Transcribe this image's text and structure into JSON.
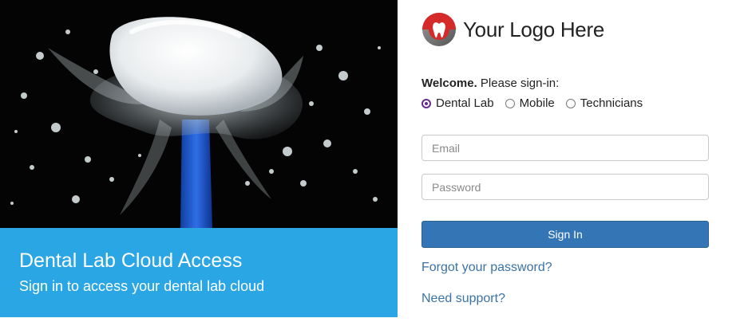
{
  "hero": {
    "title": "Dental Lab Cloud Access",
    "subtitle": "Sign in to access your dental lab cloud"
  },
  "logo": {
    "text": "Your Logo Here",
    "icon": "tooth-icon"
  },
  "signin_form": {
    "welcome_bold": "Welcome.",
    "welcome_rest": " Please sign-in:",
    "roles": [
      {
        "label": "Dental Lab",
        "checked": true
      },
      {
        "label": "Mobile",
        "checked": false
      },
      {
        "label": "Technicians",
        "checked": false
      }
    ],
    "email": {
      "placeholder": "Email",
      "value": ""
    },
    "password": {
      "placeholder": "Password",
      "value": ""
    },
    "submit_label": "Sign In",
    "forgot_link": "Forgot your password?",
    "support_link": "Need support?"
  },
  "colors": {
    "banner": "#29a6e3",
    "button": "#3476b5",
    "link": "#3a73a6",
    "radio_selected": "#6a2c8c",
    "logo_red": "#d42a2a"
  }
}
